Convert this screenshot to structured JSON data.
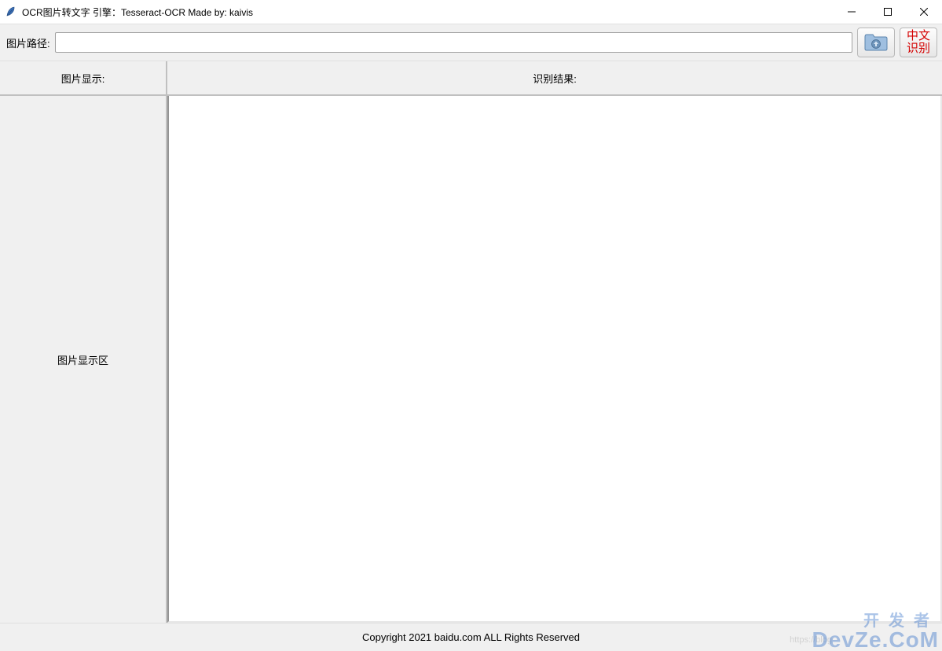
{
  "window": {
    "title": "OCR图片转文字  引擎：Tesseract-OCR  Made by: kaivis"
  },
  "toolbar": {
    "path_label": "图片路径:",
    "path_value": "",
    "upload_title": "打开图片",
    "recognize_label": "中文\n识别"
  },
  "panels": {
    "left_header": "图片显示:",
    "left_placeholder": "图片显示区",
    "right_header": "识别结果:"
  },
  "footer": {
    "copyright": "Copyright 2021 baidu.com ALL Rights Reserved"
  },
  "watermark": {
    "line1": "开发者",
    "line2": "DevZe.CoM",
    "url_hint": "https://blog"
  }
}
